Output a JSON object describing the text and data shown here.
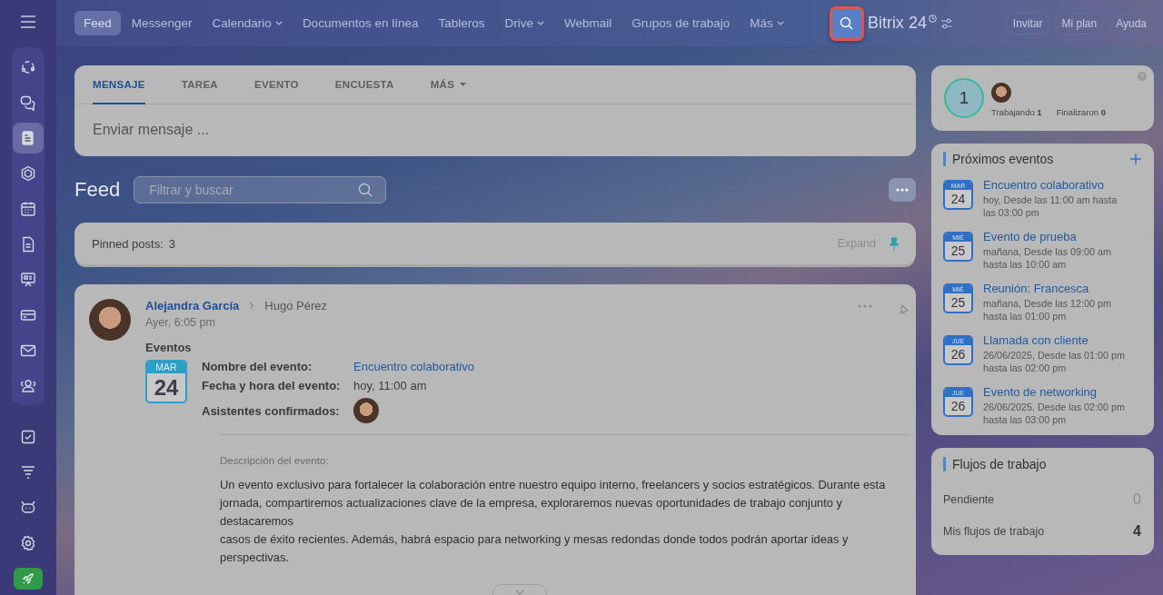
{
  "topnav": {
    "items": [
      {
        "label": "Feed",
        "selected": true,
        "has_menu": false
      },
      {
        "label": "Messenger",
        "selected": false,
        "has_menu": false
      },
      {
        "label": "Calendario",
        "selected": false,
        "has_menu": true
      },
      {
        "label": "Documentos en línea",
        "selected": false,
        "has_menu": false
      },
      {
        "label": "Tableros",
        "selected": false,
        "has_menu": false
      },
      {
        "label": "Drive",
        "selected": false,
        "has_menu": true
      },
      {
        "label": "Webmail",
        "selected": false,
        "has_menu": false
      },
      {
        "label": "Grupos de trabajo",
        "selected": false,
        "has_menu": false
      },
      {
        "label": "Más",
        "selected": false,
        "has_menu": true
      }
    ],
    "brand": "Bitrix",
    "brand_suffix": "24",
    "buttons": [
      "Invitar",
      "Mi plan",
      "Ayuda"
    ]
  },
  "sidebar": {
    "items": [
      {
        "selected": false
      },
      {
        "selected": false
      },
      {
        "selected": true
      },
      {
        "selected": false
      },
      {
        "selected": false
      },
      {
        "selected": false
      },
      {
        "selected": false
      },
      {
        "selected": false
      },
      {
        "selected": false
      },
      {
        "selected": false
      },
      {
        "selected": false
      },
      {
        "selected": false
      },
      {
        "selected": false
      },
      {
        "selected": false
      }
    ]
  },
  "composer": {
    "tabs": [
      {
        "label": "MENSAJE",
        "selected": true,
        "has_menu": false
      },
      {
        "label": "TAREA",
        "selected": false,
        "has_menu": false
      },
      {
        "label": "EVENTO",
        "selected": false,
        "has_menu": false
      },
      {
        "label": "ENCUESTA",
        "selected": false,
        "has_menu": false
      },
      {
        "label": "MÁS",
        "selected": false,
        "has_menu": true
      }
    ],
    "placeholder": "Enviar mensaje ..."
  },
  "feed": {
    "title": "Feed",
    "search_placeholder": "Filtrar y buscar"
  },
  "pinned": {
    "label": "Pinned posts:",
    "count": "3",
    "action": "Expand"
  },
  "post": {
    "author": "Alejandra García",
    "recipient": "Hugo Pérez",
    "time": "Ayer, 6:05 pm",
    "heading": "Eventos",
    "date": {
      "month": "MAR",
      "day": "24"
    },
    "fields": [
      {
        "label": "Nombre del evento:",
        "value": "Encuentro colaborativo",
        "kind": "link"
      },
      {
        "label": "Fecha y hora del evento:",
        "value": "hoy, 11:00 am",
        "kind": "text"
      },
      {
        "label": "Asistentes confirmados:",
        "kind": "avatars"
      }
    ],
    "description_label": "Descripción del evento:",
    "description": [
      "Un evento exclusivo para fortalecer la colaboración entre nuestro equipo interno, freelancers y socios estratégicos. Durante esta jornada, compartiremos actualizaciones clave de la empresa, exploraremos nuevas oportunidades de trabajo conjunto y destacaremos",
      "casos de éxito recientes. Además, habrá espacio para networking y mesas redondas donde todos podrán aportar ideas y perspectivas."
    ]
  },
  "status": {
    "count": "1",
    "items": [
      {
        "label": "Trabajando",
        "value": "1"
      },
      {
        "label": "Finalizaron",
        "value": "0"
      }
    ]
  },
  "events": {
    "title": "Próximos eventos",
    "items": [
      {
        "month": "MAR",
        "day": "24",
        "title": "Encuentro colaborativo",
        "when": "hoy, Desde las 11:00 am hasta las 03:00 pm"
      },
      {
        "month": "MIÉ",
        "day": "25",
        "title": "Evento de prueba",
        "when": "mañana, Desde las 09:00 am hasta las 10:00 am"
      },
      {
        "month": "MIÉ",
        "day": "25",
        "title": "Reunión: Francesca",
        "when": "mañana, Desde las 12:00 pm hasta las 01:00 pm"
      },
      {
        "month": "JUE",
        "day": "26",
        "title": "Llamada con cliente",
        "when": "26/06/2025, Desde las 01:00 pm hasta las 02:00 pm"
      },
      {
        "month": "JUE",
        "day": "26",
        "title": "Evento de networking",
        "when": "26/06/2025, Desde las 02:00 pm hasta las 03:00 pm"
      }
    ]
  },
  "workflows": {
    "title": "Flujos de trabajo",
    "items": [
      {
        "label": "Pendiente",
        "value": "0",
        "muted": true
      },
      {
        "label": "Mis flujos de trabajo",
        "value": "4",
        "muted": false
      }
    ]
  }
}
